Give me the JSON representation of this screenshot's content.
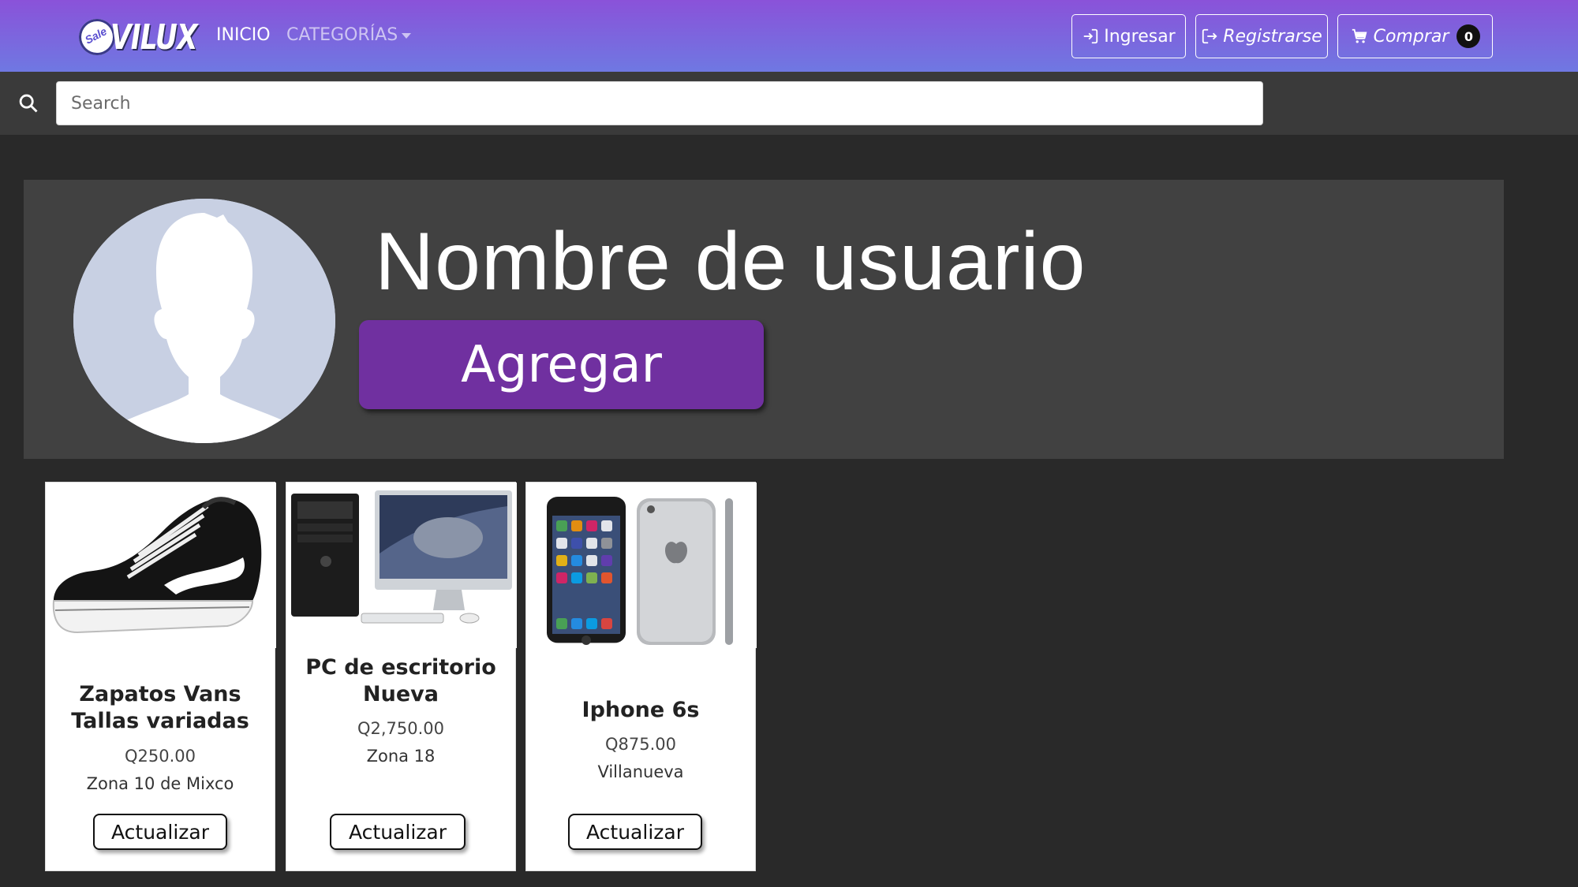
{
  "navbar": {
    "logo_badge": "Sale",
    "logo_text": "VILUX",
    "links": [
      {
        "label": "INICIO"
      },
      {
        "label": "CATEGORÍAS"
      }
    ],
    "ingresar_label": "Ingresar",
    "registrarse_label": "Registrarse",
    "comprar_label": "Comprar",
    "cart_count": "0",
    "colors": {
      "gradient_top": "#8a52d9",
      "gradient_bottom": "#6f78e2"
    }
  },
  "search": {
    "placeholder": "Search",
    "value": ""
  },
  "profile": {
    "username": "Nombre de usuario",
    "add_button_label": "Agregar",
    "accent": "#7030a0"
  },
  "products": [
    {
      "title": "Zapatos Vans Tallas variadas",
      "price": "Q250.00",
      "location": "Zona 10 de Mixco",
      "button_label": "Actualizar",
      "image_icon": "sneaker-image"
    },
    {
      "title": "PC de escritorio Nueva",
      "price": "Q2,750.00",
      "location": "Zona 18",
      "button_label": "Actualizar",
      "image_icon": "desktop-pc-image"
    },
    {
      "title": "Iphone 6s",
      "price": "Q875.00",
      "location": "Villanueva",
      "button_label": "Actualizar",
      "image_icon": "iphone-image"
    }
  ]
}
